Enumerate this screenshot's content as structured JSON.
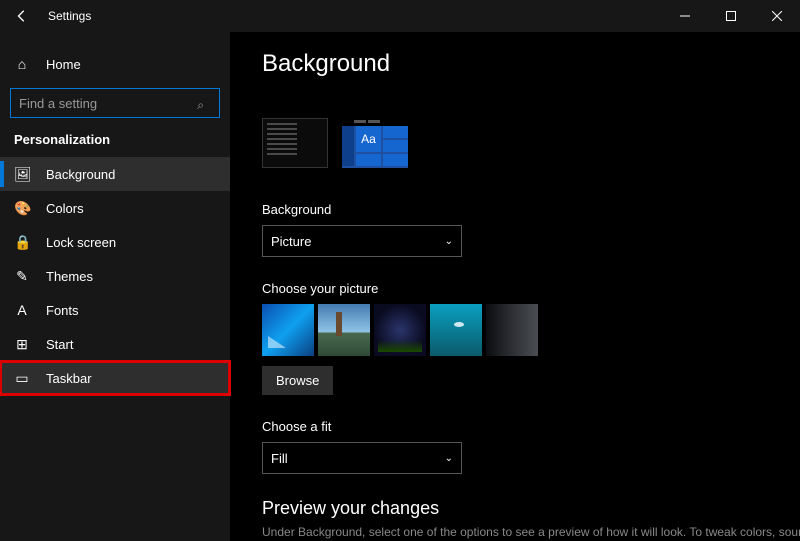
{
  "window": {
    "title": "Settings"
  },
  "sidebar": {
    "home_label": "Home",
    "search_placeholder": "Find a setting",
    "section_label": "Personalization",
    "items": [
      {
        "icon": "🖼",
        "label": "Background",
        "state": "selected"
      },
      {
        "icon": "🎨",
        "label": "Colors",
        "state": ""
      },
      {
        "icon": "🔒",
        "label": "Lock screen",
        "state": ""
      },
      {
        "icon": "✎",
        "label": "Themes",
        "state": ""
      },
      {
        "icon": "A",
        "label": "Fonts",
        "state": ""
      },
      {
        "icon": "⊞",
        "label": "Start",
        "state": ""
      },
      {
        "icon": "▭",
        "label": "Taskbar",
        "state": "highlighted"
      }
    ]
  },
  "main": {
    "page_title": "Background",
    "preview_sample_text": "Aa",
    "background_label": "Background",
    "background_value": "Picture",
    "choose_picture_label": "Choose your picture",
    "browse_label": "Browse",
    "choose_fit_label": "Choose a fit",
    "fit_value": "Fill",
    "preview_changes_heading": "Preview your changes",
    "cutoff_text": "Under Background, select one of the options to see a preview of how it will look. To tweak colors, sounds, and"
  }
}
